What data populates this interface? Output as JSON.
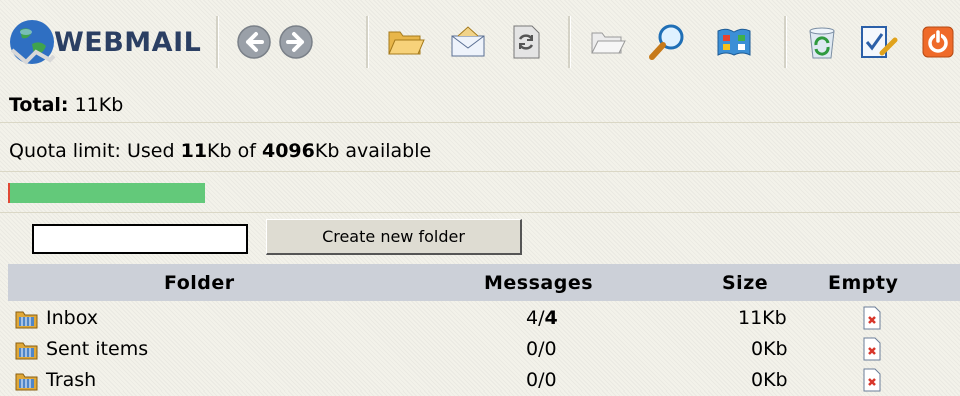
{
  "app": {
    "logo_text": "WEBMAIL"
  },
  "toolbar": {
    "icons": [
      "back-icon",
      "forward-icon",
      "open-folder-icon",
      "compose-icon",
      "refresh-icon",
      "folders-icon",
      "search-icon",
      "address-book-icon",
      "recycle-bin-icon",
      "preferences-icon",
      "logout-icon"
    ]
  },
  "total": {
    "label": "Total:",
    "value": "11Kb"
  },
  "quota": {
    "prefix": "Quota limit: Used ",
    "used": "11",
    "mid": "Kb of ",
    "limit": "4096",
    "suffix": "Kb available",
    "fraction_used": 0.0027
  },
  "create_folder": {
    "input_value": "",
    "button_label": "Create new folder"
  },
  "table": {
    "headers": {
      "folder": "Folder",
      "messages": "Messages",
      "size": "Size",
      "empty": "Empty"
    },
    "rows": [
      {
        "name": "Inbox",
        "messages": "4/",
        "messages_bold": "4",
        "size": "11Kb"
      },
      {
        "name": "Sent items",
        "messages": "0/0",
        "messages_bold": "",
        "size": "0Kb"
      },
      {
        "name": "Trash",
        "messages": "0/0",
        "messages_bold": "",
        "size": "0Kb"
      }
    ]
  },
  "colors": {
    "quota_bar": "#63c97a",
    "header_bg": "#ccd0d8",
    "page_bg": "#f3f2ea"
  }
}
